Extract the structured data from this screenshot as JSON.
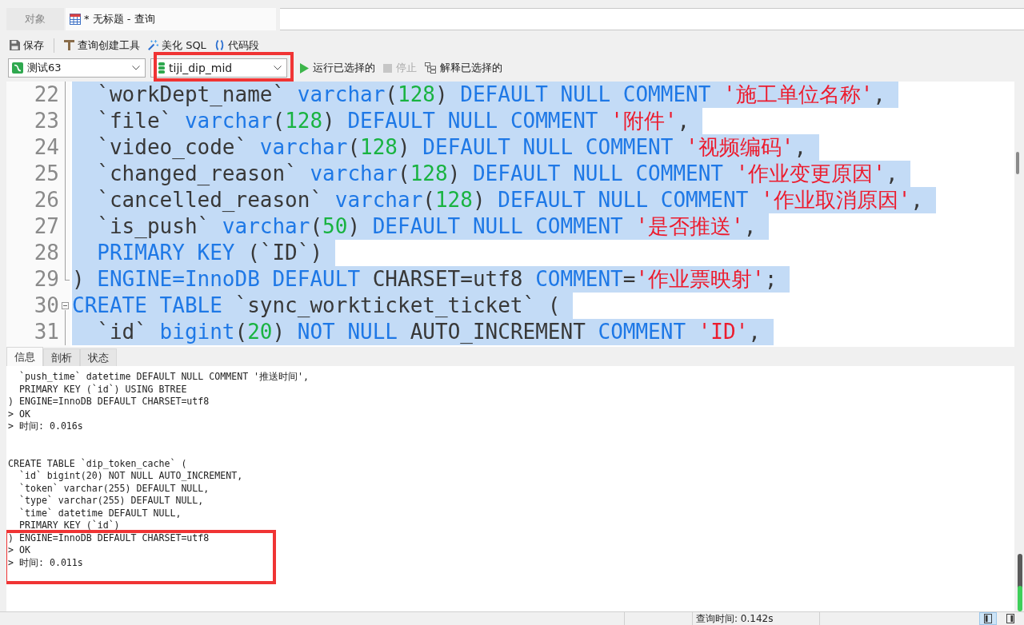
{
  "tabs": [
    {
      "kind": "objects",
      "label": "对象",
      "selected": false
    },
    {
      "kind": "query",
      "label": "* 无标题 - 查询",
      "selected": true
    }
  ],
  "toolbar": [
    {
      "kind": "save",
      "label": "保存"
    },
    {
      "kind": "query-builder",
      "label": "查询创建工具"
    },
    {
      "kind": "beautify",
      "label": "美化 SQL"
    },
    {
      "kind": "snippet",
      "label": "代码段"
    }
  ],
  "connection": {
    "value": "测试63"
  },
  "database": {
    "value": "tiji_dip_mid",
    "annotated": true
  },
  "actions": [
    {
      "kind": "run",
      "label": "运行已选择的",
      "disabled": false
    },
    {
      "kind": "stop",
      "label": "停止",
      "disabled": true
    },
    {
      "kind": "explain",
      "label": "解释已选择的",
      "disabled": false
    }
  ],
  "editor": {
    "lines": [
      {
        "number": "22",
        "kind": "line",
        "selected": true,
        "tokens": [
          {
            "kind": "plain",
            "text": "  `workDept_name` "
          },
          {
            "kind": "keyword",
            "text": "varchar"
          },
          {
            "kind": "plain",
            "text": "("
          },
          {
            "kind": "number",
            "text": "128"
          },
          {
            "kind": "plain",
            "text": ") "
          },
          {
            "kind": "keyword",
            "text": "DEFAULT NULL COMMENT "
          },
          {
            "kind": "string",
            "text": "'施工单位名称'"
          },
          {
            "kind": "plain",
            "text": ","
          }
        ]
      },
      {
        "number": "23",
        "kind": "line",
        "selected": true,
        "tokens": [
          {
            "kind": "plain",
            "text": "  `file` "
          },
          {
            "kind": "keyword",
            "text": "varchar"
          },
          {
            "kind": "plain",
            "text": "("
          },
          {
            "kind": "number",
            "text": "128"
          },
          {
            "kind": "plain",
            "text": ") "
          },
          {
            "kind": "keyword",
            "text": "DEFAULT NULL COMMENT "
          },
          {
            "kind": "string",
            "text": "'附件'"
          },
          {
            "kind": "plain",
            "text": ","
          }
        ]
      },
      {
        "number": "24",
        "kind": "line",
        "selected": true,
        "tokens": [
          {
            "kind": "plain",
            "text": "  `video_code` "
          },
          {
            "kind": "keyword",
            "text": "varchar"
          },
          {
            "kind": "plain",
            "text": "("
          },
          {
            "kind": "number",
            "text": "128"
          },
          {
            "kind": "plain",
            "text": ") "
          },
          {
            "kind": "keyword",
            "text": "DEFAULT NULL COMMENT "
          },
          {
            "kind": "string",
            "text": "'视频编码'"
          },
          {
            "kind": "plain",
            "text": ","
          }
        ]
      },
      {
        "number": "25",
        "kind": "line",
        "selected": true,
        "tokens": [
          {
            "kind": "plain",
            "text": "  `changed_reason` "
          },
          {
            "kind": "keyword",
            "text": "varchar"
          },
          {
            "kind": "plain",
            "text": "("
          },
          {
            "kind": "number",
            "text": "128"
          },
          {
            "kind": "plain",
            "text": ") "
          },
          {
            "kind": "keyword",
            "text": "DEFAULT NULL COMMENT "
          },
          {
            "kind": "string",
            "text": "'作业变更原因'"
          },
          {
            "kind": "plain",
            "text": ","
          }
        ]
      },
      {
        "number": "26",
        "kind": "line",
        "selected": true,
        "tokens": [
          {
            "kind": "plain",
            "text": "  `cancelled_reason` "
          },
          {
            "kind": "keyword",
            "text": "varchar"
          },
          {
            "kind": "plain",
            "text": "("
          },
          {
            "kind": "number",
            "text": "128"
          },
          {
            "kind": "plain",
            "text": ") "
          },
          {
            "kind": "keyword",
            "text": "DEFAULT NULL COMMENT "
          },
          {
            "kind": "string",
            "text": "'作业取消原因'"
          },
          {
            "kind": "plain",
            "text": ","
          }
        ]
      },
      {
        "number": "27",
        "kind": "line",
        "selected": true,
        "tokens": [
          {
            "kind": "plain",
            "text": "  `is_push` "
          },
          {
            "kind": "keyword",
            "text": "varchar"
          },
          {
            "kind": "plain",
            "text": "("
          },
          {
            "kind": "number",
            "text": "50"
          },
          {
            "kind": "plain",
            "text": ") "
          },
          {
            "kind": "keyword",
            "text": "DEFAULT NULL COMMENT "
          },
          {
            "kind": "string",
            "text": "'是否推送'"
          },
          {
            "kind": "plain",
            "text": ","
          }
        ]
      },
      {
        "number": "28",
        "kind": "line",
        "selected": true,
        "tokens": [
          {
            "kind": "keyword",
            "text": "  PRIMARY KEY "
          },
          {
            "kind": "plain",
            "text": "(`ID`)"
          }
        ]
      },
      {
        "number": "29",
        "kind": "block-end",
        "selected": true,
        "tokens": [
          {
            "kind": "plain",
            "text": ") "
          },
          {
            "kind": "keyword",
            "text": "ENGINE=InnoDB DEFAULT "
          },
          {
            "kind": "plain",
            "text": "CHARSET=utf8 "
          },
          {
            "kind": "keyword",
            "text": "COMMENT"
          },
          {
            "kind": "plain",
            "text": "="
          },
          {
            "kind": "string",
            "text": "'作业票映射'"
          },
          {
            "kind": "plain",
            "text": ";"
          }
        ]
      },
      {
        "number": "30",
        "kind": "block-start",
        "selected": true,
        "tokens": [
          {
            "kind": "keyword",
            "text": "CREATE TABLE "
          },
          {
            "kind": "plain",
            "text": "`sync_workticket_ticket` ("
          }
        ]
      },
      {
        "number": "31",
        "kind": "line",
        "selected": true,
        "tokens": [
          {
            "kind": "plain",
            "text": "  `id` "
          },
          {
            "kind": "keyword",
            "text": "bigint"
          },
          {
            "kind": "plain",
            "text": "("
          },
          {
            "kind": "number",
            "text": "20"
          },
          {
            "kind": "plain",
            "text": ") "
          },
          {
            "kind": "keyword",
            "text": "NOT NULL "
          },
          {
            "kind": "plain",
            "text": "AUTO_INCREMENT "
          },
          {
            "kind": "keyword",
            "text": "COMMENT "
          },
          {
            "kind": "string",
            "text": "'ID'"
          },
          {
            "kind": "plain",
            "text": ","
          }
        ]
      }
    ]
  },
  "message_tabs": [
    {
      "label": "信息",
      "selected": true
    },
    {
      "label": "剖析",
      "selected": false
    },
    {
      "label": "状态",
      "selected": false
    }
  ],
  "messages": {
    "lines": [
      {
        "kind": "text",
        "text": "  `push_time` datetime DEFAULT NULL COMMENT '推送时间',"
      },
      {
        "kind": "text",
        "text": "  PRIMARY KEY (`id`) USING BTREE"
      },
      {
        "kind": "text",
        "text": ") ENGINE=InnoDB DEFAULT CHARSET=utf8"
      },
      {
        "kind": "text",
        "text": "> OK"
      },
      {
        "kind": "text",
        "text": "> 时间: 0.016s"
      },
      {
        "kind": "blank"
      },
      {
        "kind": "blank"
      },
      {
        "kind": "text",
        "text": "CREATE TABLE `dip_token_cache` ("
      },
      {
        "kind": "text",
        "text": "  `id` bigint(20) NOT NULL AUTO_INCREMENT,"
      },
      {
        "kind": "text",
        "text": "  `token` varchar(255) DEFAULT NULL,"
      },
      {
        "kind": "text",
        "text": "  `type` varchar(255) DEFAULT NULL,"
      },
      {
        "kind": "text",
        "text": "  `time` datetime DEFAULT NULL,"
      },
      {
        "kind": "text",
        "text": "  PRIMARY KEY (`id`)"
      }
    ],
    "highlighted_block": {
      "lines": [
        ") ENGINE=InnoDB DEFAULT CHARSET=utf8",
        "> OK",
        "> 时间: 0.011s"
      ]
    }
  },
  "status_bar": {
    "query_time": "查询时间: 0.142s",
    "view_buttons": [
      {
        "kind": "left-panel",
        "selected": true
      },
      {
        "kind": "right-panel",
        "selected": false
      }
    ]
  }
}
